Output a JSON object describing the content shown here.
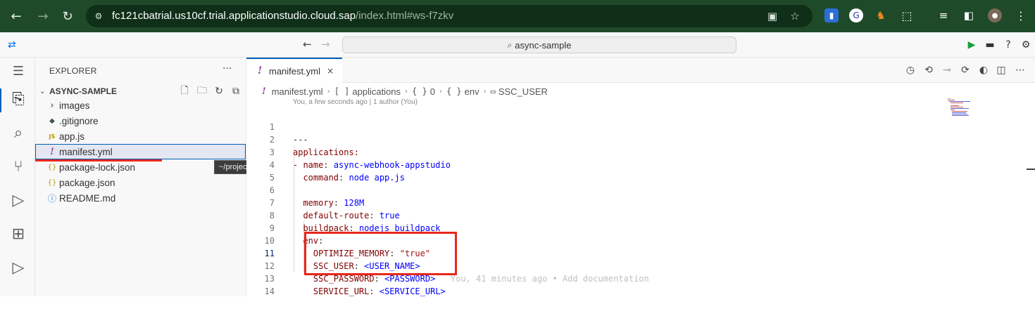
{
  "browser": {
    "url_host": "fc121cbatrial.us10cf.trial.applicationstudio.cloud.sap",
    "url_path": "/index.html#ws-f7zkv",
    "icons": [
      "back-arrow-icon",
      "forward-arrow-icon",
      "reload-icon",
      "site-info-icon",
      "screenshot-icon",
      "star-icon",
      "extensions-icon",
      "profile-icon",
      "menu-icon"
    ]
  },
  "ide": {
    "search_text": "async-sample"
  },
  "explorer": {
    "title": "EXPLORER",
    "more": "···",
    "section": "ASYNC-SAMPLE",
    "items": [
      {
        "label": "images",
        "icon": "›",
        "kind": "folder"
      },
      {
        "label": ".gitignore",
        "icon": "◆",
        "kind": "file"
      },
      {
        "label": "app.js",
        "icon": "JS",
        "kind": "file"
      },
      {
        "label": "manifest.yml",
        "icon": "!",
        "kind": "file"
      },
      {
        "label": "package-lock.json",
        "icon": "{}",
        "kind": "file"
      },
      {
        "label": "package.json",
        "icon": "{}",
        "kind": "file"
      },
      {
        "label": "README.md",
        "icon": "ⓘ",
        "kind": "file"
      }
    ],
    "tooltip": "~/projects/async-sample/manifest.yml"
  },
  "editor": {
    "tab_label": "manifest.yml",
    "tab_close": "×",
    "breadcrumb": {
      "file": "manifest.yml",
      "applications": "applications",
      "index": "0",
      "env": "env",
      "key": "SSC_USER"
    },
    "blame": "You, a few seconds ago | 1 author (You)",
    "ghost_text": "You, 41 minutes ago • Add documentation",
    "lines": [
      {
        "n": "1",
        "text": "---"
      },
      {
        "n": "2",
        "text": "applications:"
      },
      {
        "n": "3",
        "text": "- name: async-webhook-appstudio"
      },
      {
        "n": "4",
        "text": "  command: node app.js"
      },
      {
        "n": "5",
        "text": ""
      },
      {
        "n": "6",
        "text": "  memory: 128M"
      },
      {
        "n": "7",
        "text": "  default-route: true"
      },
      {
        "n": "8",
        "text": "  buildpack: nodejs_buildpack"
      },
      {
        "n": "9",
        "text": "  env:"
      },
      {
        "n": "10",
        "text": "    OPTIMIZE_MEMORY: \"true\""
      },
      {
        "n": "11",
        "text": "    SSC_USER: <USER_NAME>"
      },
      {
        "n": "12",
        "text": "    SSC_PASSWORD: <PASSWORD>"
      },
      {
        "n": "13",
        "text": "    SERVICE_URL: <SERVICE_URL>"
      },
      {
        "n": "14",
        "text": ""
      }
    ]
  },
  "colors": {
    "browser_bar": "#1f4a2a",
    "accent": "#005fb8",
    "highlight_red": "#e8281b",
    "yaml_key": "#800000",
    "yaml_value": "#0000ff"
  }
}
